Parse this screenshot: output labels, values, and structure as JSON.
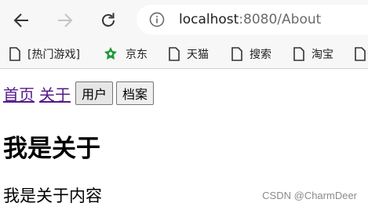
{
  "browser": {
    "url_host": "localhost",
    "url_rest": ":8080/About"
  },
  "bookmarks": [
    {
      "label": "[热门游戏]",
      "icon": "page-icon"
    },
    {
      "label": "京东",
      "icon": "jd-icon"
    },
    {
      "label": "天猫",
      "icon": "page-icon"
    },
    {
      "label": "搜索",
      "icon": "page-icon"
    },
    {
      "label": "淘宝",
      "icon": "page-icon"
    }
  ],
  "page": {
    "links": [
      "首页",
      "关于"
    ],
    "buttons": [
      "用户",
      "档案"
    ],
    "heading": "我是关于",
    "content": "我是关于内容"
  },
  "watermark": "CSDN @CharmDeer"
}
